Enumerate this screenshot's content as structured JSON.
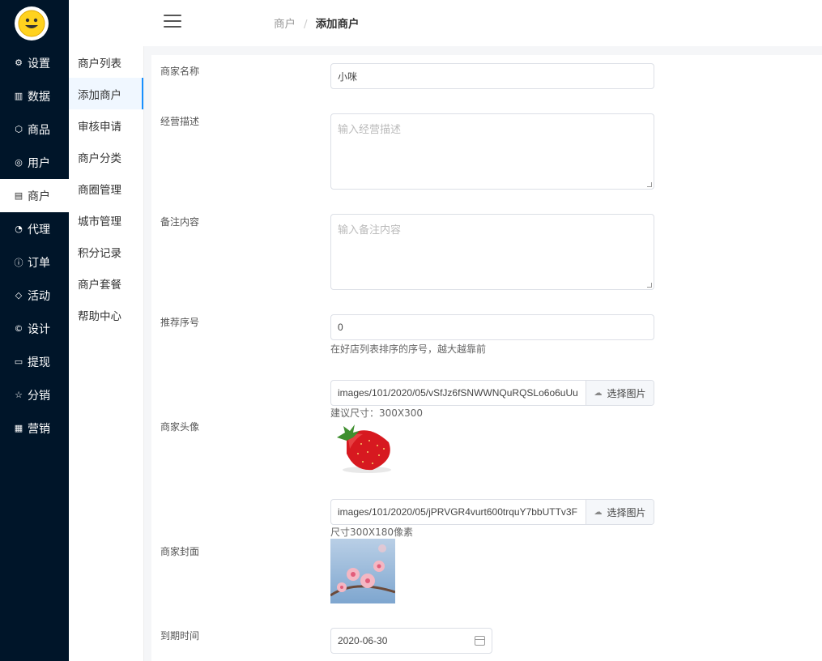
{
  "sidebar": {
    "items": [
      {
        "label": "设置",
        "icon": "gear-icon",
        "glyph": "⚙"
      },
      {
        "label": "数据",
        "icon": "chart-icon",
        "glyph": "▥"
      },
      {
        "label": "商品",
        "icon": "box-icon",
        "glyph": "⬡"
      },
      {
        "label": "用户",
        "icon": "user-icon",
        "glyph": "◎"
      },
      {
        "label": "商户",
        "icon": "list-icon",
        "glyph": "▤"
      },
      {
        "label": "代理",
        "icon": "pie-icon",
        "glyph": "◔"
      },
      {
        "label": "订单",
        "icon": "info-icon",
        "glyph": "ⓘ"
      },
      {
        "label": "活动",
        "icon": "tag-icon",
        "glyph": "◇"
      },
      {
        "label": "设计",
        "icon": "copyright-icon",
        "glyph": "©"
      },
      {
        "label": "提现",
        "icon": "card-icon",
        "glyph": "▭"
      },
      {
        "label": "分销",
        "icon": "star-icon",
        "glyph": "☆"
      },
      {
        "label": "营销",
        "icon": "grid-icon",
        "glyph": "▦"
      }
    ]
  },
  "submenu": {
    "items": [
      "商户列表",
      "添加商户",
      "审核申请",
      "商户分类",
      "商圈管理",
      "城市管理",
      "积分记录",
      "商户套餐",
      "帮助中心"
    ]
  },
  "header": {
    "breadcrumb_parent": "商户",
    "breadcrumb_sep": "/",
    "breadcrumb_current": "添加商户"
  },
  "form": {
    "name_label": "商家名称",
    "name_value": "小咪",
    "desc_label": "经营描述",
    "desc_placeholder": "输入经营描述",
    "remark_label": "备注内容",
    "remark_placeholder": "输入备注内容",
    "sort_label": "推荐序号",
    "sort_value": "0",
    "sort_hint": "在好店列表排序的序号，越大越靠前",
    "avatar_label": "商家头像",
    "avatar_path": "images/101/2020/05/vSfJz6fSNWWNQuRQSLo6o6uUu",
    "avatar_btn": "选择图片",
    "avatar_hint": "建议尺寸：300X300",
    "cover_label": "商家封面",
    "cover_path": "images/101/2020/05/jPRVGR4vurt600trquY7bbUTTv3F",
    "cover_btn": "选择图片",
    "cover_hint": "尺寸300X180像素",
    "expire_label": "到期时间",
    "expire_value": "2020-06-30"
  },
  "colors": {
    "sidebar_bg": "#001529",
    "accent": "#1890ff"
  }
}
